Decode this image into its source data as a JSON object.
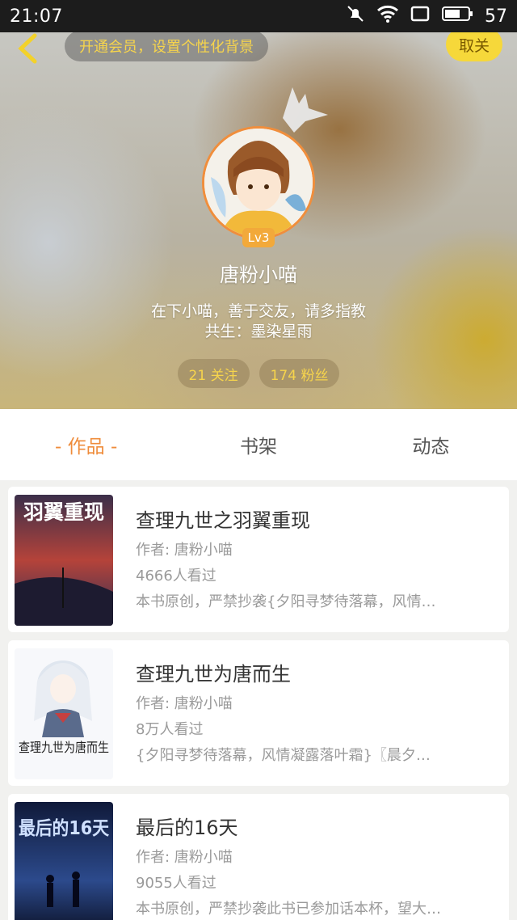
{
  "status_bar": {
    "time": "21:07",
    "battery": "57"
  },
  "header": {
    "vip_prompt": "开通会员，设置个性化背景",
    "unfollow_label": "取关",
    "level": "Lv3",
    "nickname": "唐粉小喵",
    "bio_line1": "在下小喵，善于交友，请多指教",
    "bio_line2": "共生：墨染星雨",
    "following": "21 关注",
    "followers": "174 粉丝"
  },
  "tabs": [
    "- 作品 -",
    "书架",
    "动态"
  ],
  "works": [
    {
      "title": "查理九世之羽翼重现",
      "author": "作者: 唐粉小喵",
      "views": "4666人看过",
      "desc": "本书原创，严禁抄袭{夕阳寻梦待落幕，风情…",
      "cover_text": "羽翼重现"
    },
    {
      "title": "查理九世为唐而生",
      "author": "作者: 唐粉小喵",
      "views": "8万人看过",
      "desc": "{夕阳寻梦待落幕，风情凝露落叶霜}〖晨夕…",
      "cover_text": "查理九世为唐而生"
    },
    {
      "title": "最后的16天",
      "author": "作者: 唐粉小喵",
      "views": "9055人看过",
      "desc": "本书原创，严禁抄袭此书已参加话本杯，望大…",
      "cover_text": "最后的16天"
    }
  ]
}
